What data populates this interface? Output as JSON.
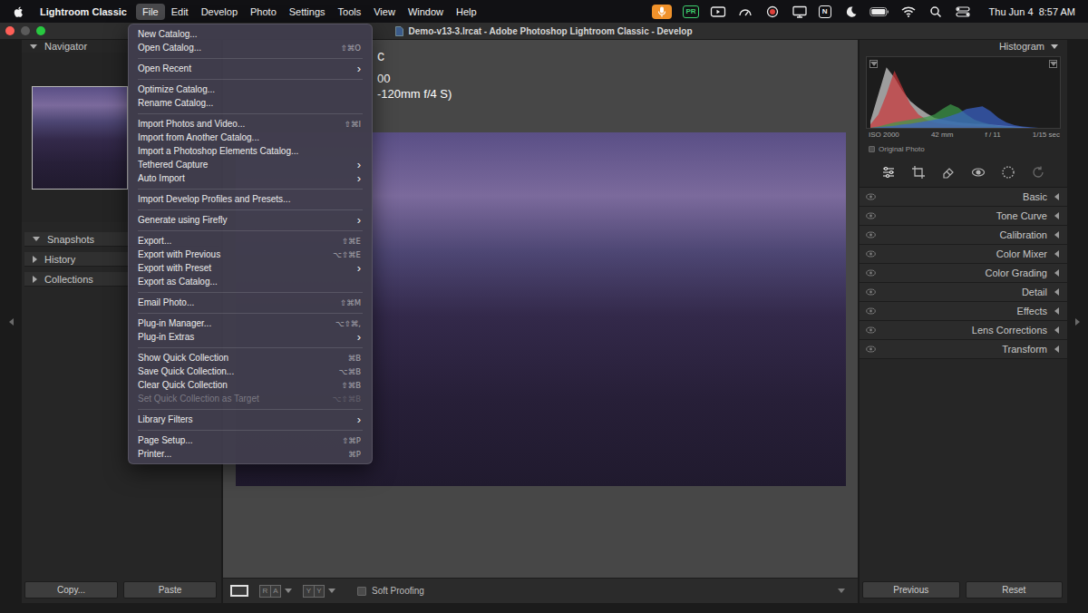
{
  "menu_bar": {
    "app": "Lightroom Classic",
    "items": [
      {
        "label": "File",
        "selected": true
      },
      {
        "label": "Edit",
        "selected": false
      },
      {
        "label": "Develop",
        "selected": false
      },
      {
        "label": "Photo",
        "selected": false
      },
      {
        "label": "Settings",
        "selected": false
      },
      {
        "label": "Tools",
        "selected": false
      },
      {
        "label": "View",
        "selected": false
      },
      {
        "label": "Window",
        "selected": false
      },
      {
        "label": "Help",
        "selected": false
      }
    ],
    "status_icons": [
      {
        "kind": "mic",
        "label": "",
        "color": "#f0922b"
      },
      {
        "kind": "badge",
        "label": "PR",
        "color": "#3ecf6e"
      },
      {
        "kind": "screen",
        "label": "",
        "color": ""
      },
      {
        "kind": "gauge",
        "label": "",
        "color": ""
      },
      {
        "kind": "record",
        "label": "",
        "color": "#e0403a"
      },
      {
        "kind": "cast",
        "label": "",
        "color": ""
      },
      {
        "kind": "badge",
        "label": "N",
        "color": "#f0f0f0"
      },
      {
        "kind": "moon",
        "label": "",
        "color": ""
      },
      {
        "kind": "battery",
        "label": "",
        "color": ""
      },
      {
        "kind": "wifi",
        "label": "",
        "color": ""
      },
      {
        "kind": "search",
        "label": "",
        "color": ""
      },
      {
        "kind": "control",
        "label": "",
        "color": ""
      }
    ],
    "clock": "Thu Jun 4  8:57 AM"
  },
  "window": {
    "title": "Demo-v13-3.lrcat - Adobe Photoshop Lightroom Classic - Develop"
  },
  "file_menu": {
    "submenu_glyph": "›",
    "groups": [
      [
        {
          "label": "New Catalog...",
          "shortcut": "",
          "submenu": false,
          "disabled": false
        },
        {
          "label": "Open Catalog...",
          "shortcut": "⇧⌘O",
          "submenu": false,
          "disabled": false
        }
      ],
      [
        {
          "label": "Open Recent",
          "shortcut": "",
          "submenu": true,
          "disabled": false
        }
      ],
      [
        {
          "label": "Optimize Catalog...",
          "shortcut": "",
          "submenu": false,
          "disabled": false
        },
        {
          "label": "Rename Catalog...",
          "shortcut": "",
          "submenu": false,
          "disabled": false
        }
      ],
      [
        {
          "label": "Import Photos and Video...",
          "shortcut": "⇧⌘I",
          "submenu": false,
          "disabled": false
        },
        {
          "label": "Import from Another Catalog...",
          "shortcut": "",
          "submenu": false,
          "disabled": false
        },
        {
          "label": "Import a Photoshop Elements Catalog...",
          "shortcut": "",
          "submenu": false,
          "disabled": false
        },
        {
          "label": "Tethered Capture",
          "shortcut": "",
          "submenu": true,
          "disabled": false
        },
        {
          "label": "Auto Import",
          "shortcut": "",
          "submenu": true,
          "disabled": false
        }
      ],
      [
        {
          "label": "Import Develop Profiles and Presets...",
          "shortcut": "",
          "submenu": false,
          "disabled": false
        }
      ],
      [
        {
          "label": "Generate using Firefly",
          "shortcut": "",
          "submenu": true,
          "disabled": false
        }
      ],
      [
        {
          "label": "Export...",
          "shortcut": "⇧⌘E",
          "submenu": false,
          "disabled": false
        },
        {
          "label": "Export with Previous",
          "shortcut": "⌥⇧⌘E",
          "submenu": false,
          "disabled": false
        },
        {
          "label": "Export with Preset",
          "shortcut": "",
          "submenu": true,
          "disabled": false
        },
        {
          "label": "Export as Catalog...",
          "shortcut": "",
          "submenu": false,
          "disabled": false
        }
      ],
      [
        {
          "label": "Email Photo...",
          "shortcut": "⇧⌘M",
          "submenu": false,
          "disabled": false
        }
      ],
      [
        {
          "label": "Plug-in Manager...",
          "shortcut": "⌥⇧⌘,",
          "submenu": false,
          "disabled": false
        },
        {
          "label": "Plug-in Extras",
          "shortcut": "",
          "submenu": true,
          "disabled": false
        }
      ],
      [
        {
          "label": "Show Quick Collection",
          "shortcut": "⌘B",
          "submenu": false,
          "disabled": false
        },
        {
          "label": "Save Quick Collection...",
          "shortcut": "⌥⌘B",
          "submenu": false,
          "disabled": false
        },
        {
          "label": "Clear Quick Collection",
          "shortcut": "⇧⌘B",
          "submenu": false,
          "disabled": false
        },
        {
          "label": "Set Quick Collection as Target",
          "shortcut": "⌥⇧⌘B",
          "submenu": false,
          "disabled": true
        }
      ],
      [
        {
          "label": "Library Filters",
          "shortcut": "",
          "submenu": true,
          "disabled": false
        }
      ],
      [
        {
          "label": "Page Setup...",
          "shortcut": "⇧⌘P",
          "submenu": false,
          "disabled": false
        },
        {
          "label": "Printer...",
          "shortcut": "⌘P",
          "submenu": false,
          "disabled": false
        }
      ]
    ]
  },
  "left_panel": {
    "navigator": {
      "title": "Navigator",
      "expanded": true
    },
    "panels": [
      {
        "title": "Snapshots",
        "expanded": true
      },
      {
        "title": "History",
        "expanded": false
      },
      {
        "title": "Collections",
        "expanded": false
      }
    ],
    "buttons": [
      "Copy...",
      "Paste"
    ]
  },
  "info_overlay": {
    "lines": [
      "c",
      "00",
      "-120mm f/4 S)"
    ]
  },
  "toolbar": {
    "compare_modes": [
      {
        "cells": [
          "R",
          "A"
        ]
      },
      {
        "cells": [
          "Y",
          "Y"
        ]
      }
    ],
    "soft_proofing": {
      "label": "Soft Proofing",
      "checked": false
    }
  },
  "right_panel": {
    "histogram": {
      "title": "Histogram",
      "expanded": true,
      "series": [
        {
          "name": "luminance",
          "color": "#d0d0d0",
          "values": [
            0.1,
            0.5,
            0.9,
            0.75,
            0.55,
            0.4,
            0.3,
            0.22,
            0.15,
            0.12,
            0.1,
            0.08,
            0.07,
            0.06,
            0.06,
            0.05,
            0.04,
            0.03,
            0.02,
            0.01,
            0,
            0,
            0,
            0
          ]
        },
        {
          "name": "red",
          "color": "#c8383a",
          "values": [
            0.05,
            0.2,
            0.5,
            0.85,
            0.6,
            0.35,
            0.2,
            0.12,
            0.08,
            0.06,
            0.05,
            0.04,
            0.03,
            0.03,
            0.02,
            0.02,
            0.01,
            0,
            0,
            0,
            0,
            0,
            0,
            0
          ]
        },
        {
          "name": "green",
          "color": "#3d9a4a",
          "values": [
            0,
            0.02,
            0.05,
            0.08,
            0.1,
            0.12,
            0.14,
            0.16,
            0.2,
            0.28,
            0.35,
            0.3,
            0.2,
            0.12,
            0.08,
            0.05,
            0.03,
            0.02,
            0.01,
            0,
            0,
            0,
            0,
            0
          ]
        },
        {
          "name": "blue",
          "color": "#3a62c8",
          "values": [
            0,
            0.01,
            0.02,
            0.03,
            0.05,
            0.06,
            0.08,
            0.1,
            0.12,
            0.14,
            0.18,
            0.22,
            0.28,
            0.3,
            0.32,
            0.25,
            0.15,
            0.08,
            0.04,
            0.02,
            0.01,
            0,
            0,
            0
          ]
        }
      ],
      "info": [
        "ISO 2000",
        "42 mm",
        "f / 11",
        "1/15 sec"
      ],
      "original_photo": {
        "label": "Original Photo",
        "checked": false
      }
    },
    "tools": [
      {
        "selected": true
      },
      {
        "selected": false
      },
      {
        "selected": false
      },
      {
        "selected": false
      },
      {
        "selected": false
      },
      {
        "selected": false
      }
    ],
    "panels": [
      {
        "title": "Basic",
        "expanded": false
      },
      {
        "title": "Tone Curve",
        "expanded": false
      },
      {
        "title": "Calibration",
        "expanded": false
      },
      {
        "title": "Color Mixer",
        "expanded": false
      },
      {
        "title": "Color Grading",
        "expanded": false
      },
      {
        "title": "Detail",
        "expanded": false
      },
      {
        "title": "Effects",
        "expanded": false
      },
      {
        "title": "Lens Corrections",
        "expanded": false
      },
      {
        "title": "Transform",
        "expanded": false
      }
    ],
    "buttons": [
      "Previous",
      "Reset"
    ]
  }
}
